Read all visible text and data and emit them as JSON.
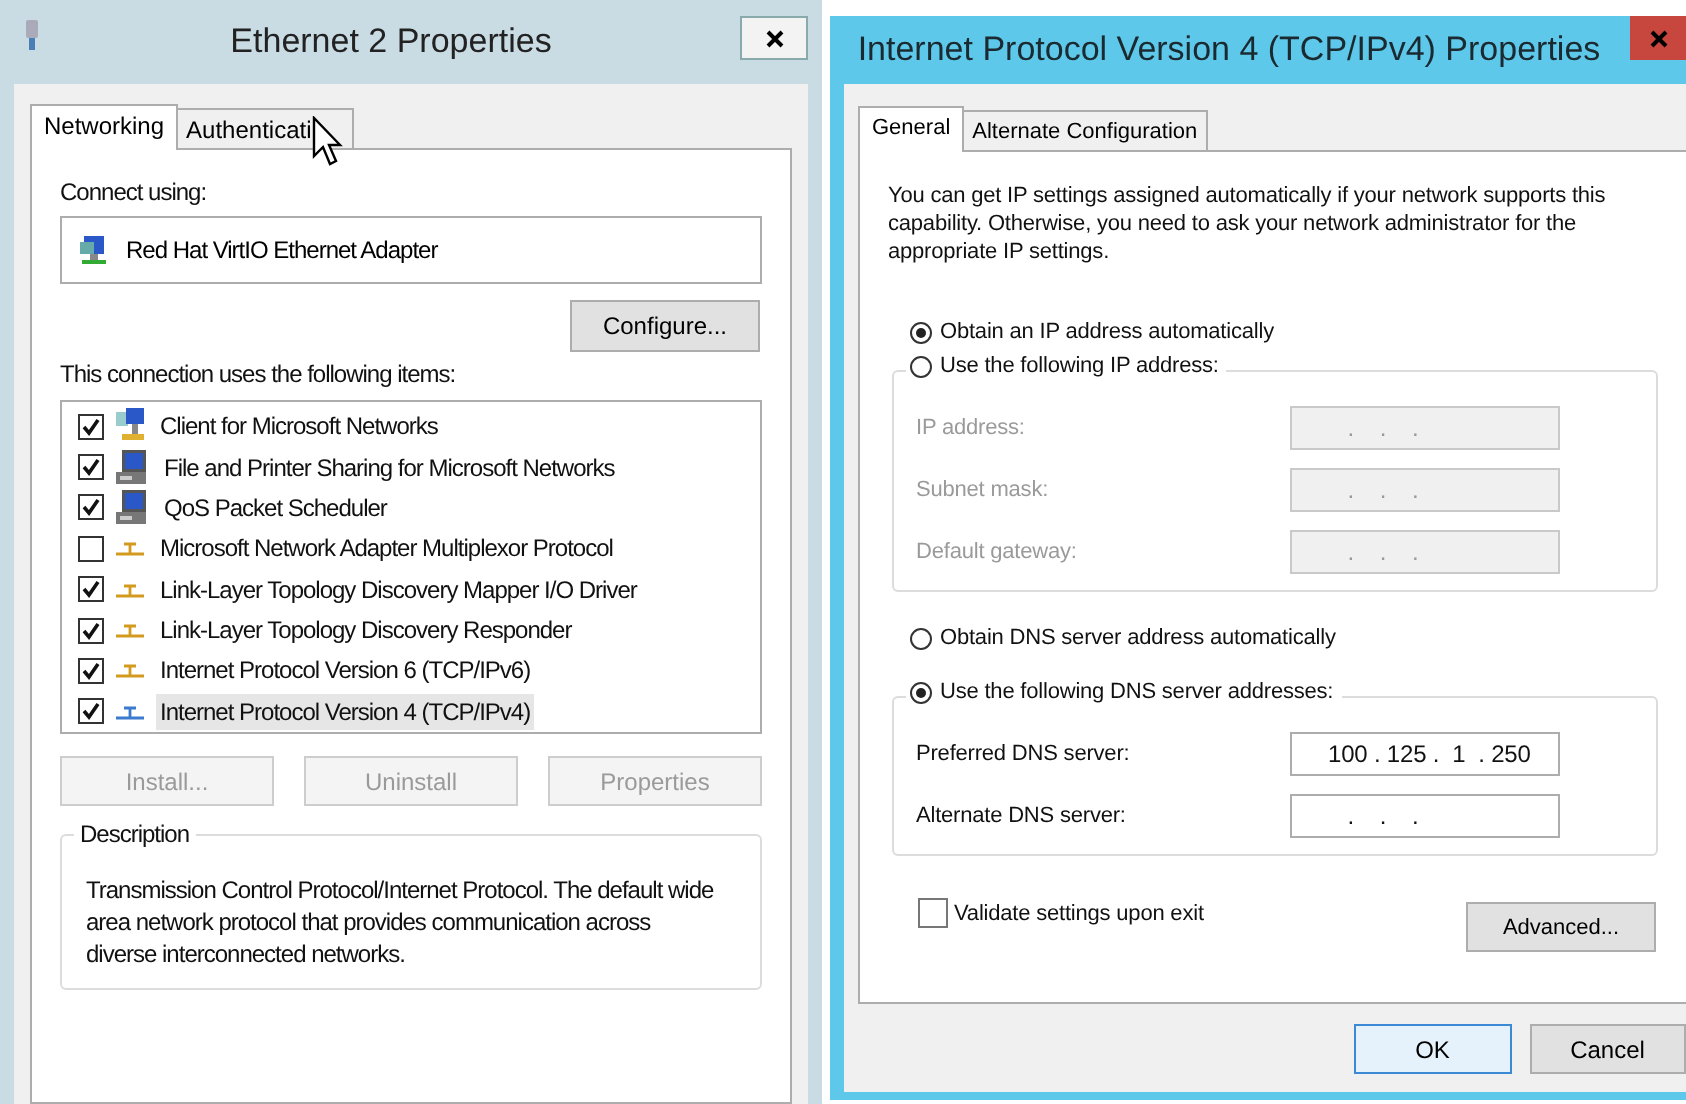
{
  "ethernet_window": {
    "title": "Ethernet 2 Properties",
    "tabs": [
      {
        "label": "Networking",
        "selected": true
      },
      {
        "label": "Authenticati",
        "selected": false
      }
    ],
    "connect_using_label": "Connect using:",
    "adapter": "Red Hat VirtIO Ethernet Adapter",
    "configure_button": "Configure...",
    "items_label": "This connection uses the following items:",
    "items": [
      {
        "label": "Client for Microsoft Networks",
        "kind": "client",
        "checked": true,
        "selected": false
      },
      {
        "label": "File and Printer Sharing for Microsoft Networks",
        "kind": "service",
        "checked": true,
        "selected": false
      },
      {
        "label": "QoS Packet Scheduler",
        "kind": "service",
        "checked": true,
        "selected": false
      },
      {
        "label": "Microsoft Network Adapter Multiplexor Protocol",
        "kind": "protocol",
        "checked": false,
        "selected": false
      },
      {
        "label": "Link-Layer Topology Discovery Mapper I/O Driver",
        "kind": "protocol",
        "checked": true,
        "selected": false
      },
      {
        "label": "Link-Layer Topology Discovery Responder",
        "kind": "protocol",
        "checked": true,
        "selected": false
      },
      {
        "label": "Internet Protocol Version 6 (TCP/IPv6)",
        "kind": "protocol",
        "checked": true,
        "selected": false
      },
      {
        "label": "Internet Protocol Version 4 (TCP/IPv4)",
        "kind": "protocol",
        "checked": true,
        "selected": true
      }
    ],
    "buttons": [
      {
        "label": "Install...",
        "disabled": true
      },
      {
        "label": "Uninstall",
        "disabled": true
      },
      {
        "label": "Properties",
        "disabled": true
      }
    ],
    "description": {
      "title": "Description",
      "text": "Transmission Control Protocol/Internet Protocol. The default wide area network protocol that provides communication across diverse interconnected networks."
    }
  },
  "ipv4_window": {
    "title": "Internet Protocol Version 4 (TCP/IPv4) Properties",
    "tabs": [
      {
        "label": "General",
        "selected": true
      },
      {
        "label": "Alternate Configuration",
        "selected": false
      }
    ],
    "intro": "You can get IP settings assigned automatically if your network supports this capability. Otherwise, you need to ask your network administrator for the appropriate IP settings.",
    "ip_options": [
      {
        "label": "Obtain an IP address automatically",
        "selected": true
      },
      {
        "label": "Use the following IP address:",
        "selected": false
      }
    ],
    "ip_fields": [
      {
        "label": "IP address:",
        "value": "   .    .    .",
        "disabled": true
      },
      {
        "label": "Subnet mask:",
        "value": "   .    .    .",
        "disabled": true
      },
      {
        "label": "Default gateway:",
        "value": "   .    .    .",
        "disabled": true
      }
    ],
    "dns_options": [
      {
        "label": "Obtain DNS server address automatically",
        "selected": false
      },
      {
        "label": "Use the following DNS server addresses:",
        "selected": true
      }
    ],
    "dns_fields": [
      {
        "label": "Preferred DNS server:",
        "value": "100 . 125 .  1  . 250",
        "disabled": false
      },
      {
        "label": "Alternate DNS server:",
        "value": "   .    .    .",
        "disabled": false
      }
    ],
    "validate": {
      "label": "Validate settings upon exit",
      "checked": false
    },
    "advanced_button": "Advanced...",
    "buttons": [
      {
        "label": "OK",
        "default": true
      },
      {
        "label": "Cancel",
        "default": false
      }
    ]
  }
}
